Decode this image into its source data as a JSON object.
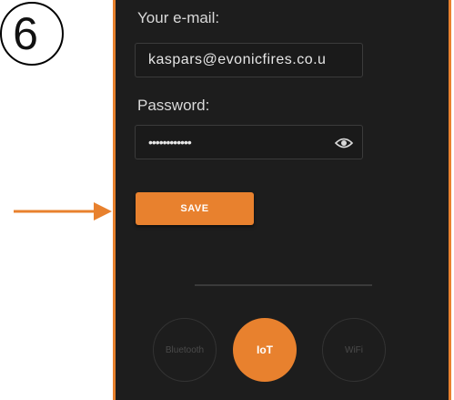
{
  "step": {
    "number": "6"
  },
  "colors": {
    "accent": "#e8812e",
    "background": "#1d1d1d"
  },
  "form": {
    "email_label": "Your e-mail:",
    "email_value": "kaspars@evonicfires.co.u",
    "password_label": "Password:",
    "password_value": "••••••••••••",
    "show_password_icon": "eye-icon",
    "save_label": "SAVE"
  },
  "modes": [
    {
      "label": "Bluetooth",
      "active": false
    },
    {
      "label": "IoT",
      "active": true
    },
    {
      "label": "WiFi",
      "active": false
    }
  ]
}
